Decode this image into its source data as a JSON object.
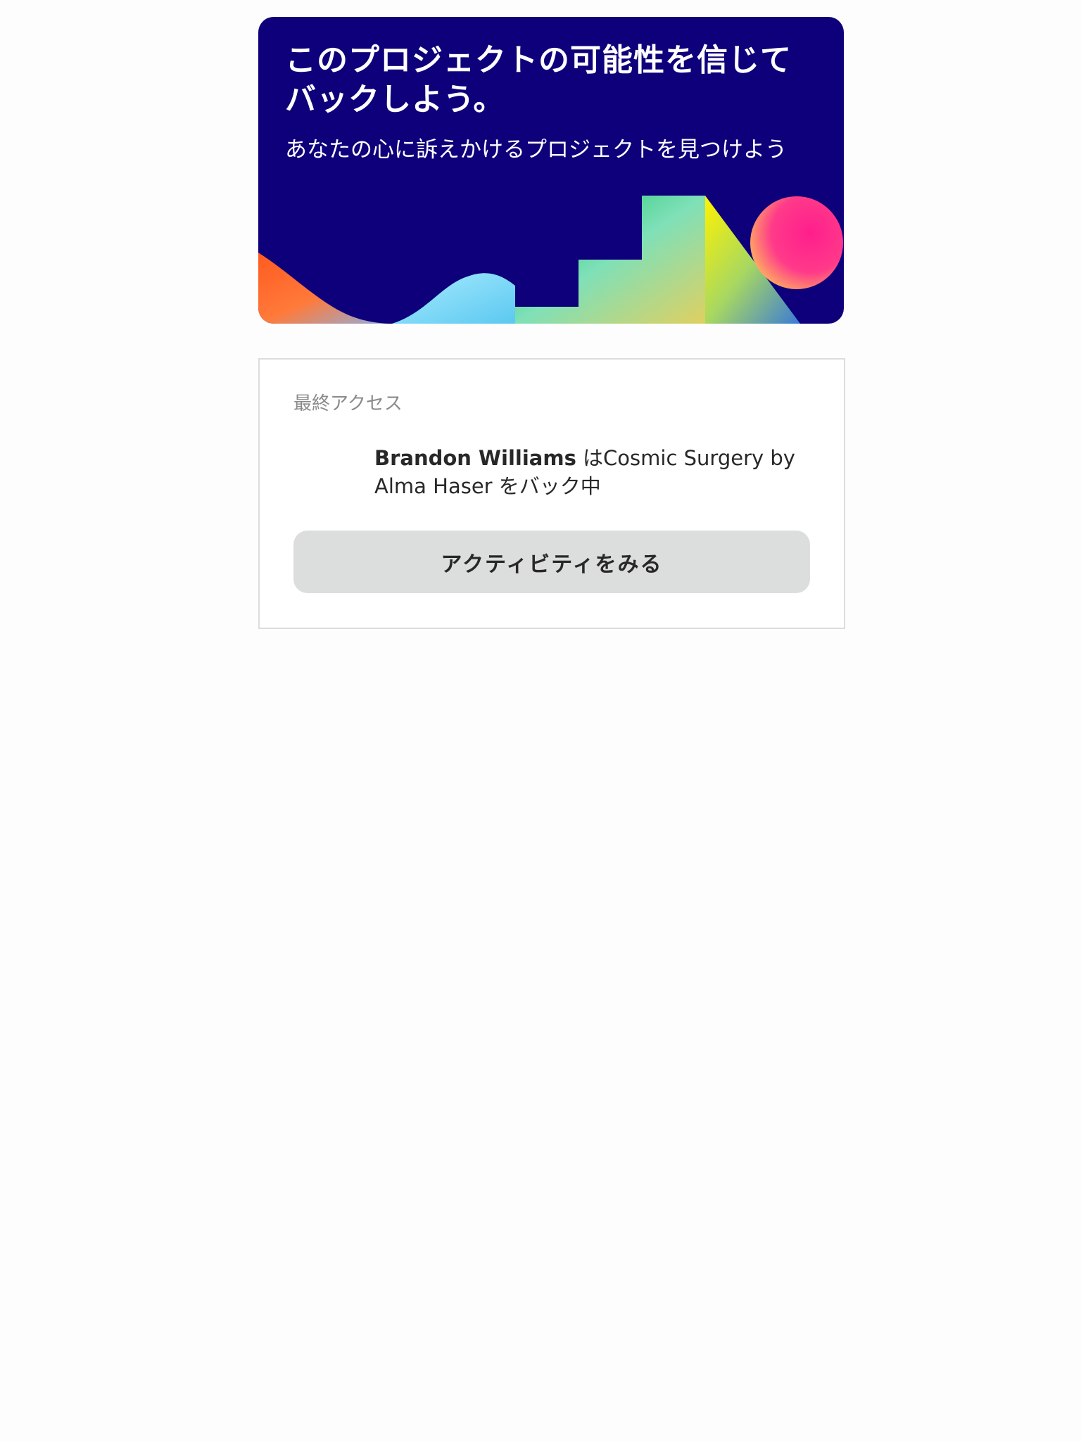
{
  "hero": {
    "title": "このプロジェクトの可能性を信じてバックしよう。",
    "subtitle": "あなたの心に訴えかけるプロジェクトを見つけよう",
    "background_color": "#0e007a"
  },
  "recent_activity": {
    "label": "最終アクセス",
    "backer_name": "Brandon Williams",
    "activity_text": " はCosmic Surgery by Alma Haser をバック中",
    "button_label": "アクティビティをみる"
  }
}
